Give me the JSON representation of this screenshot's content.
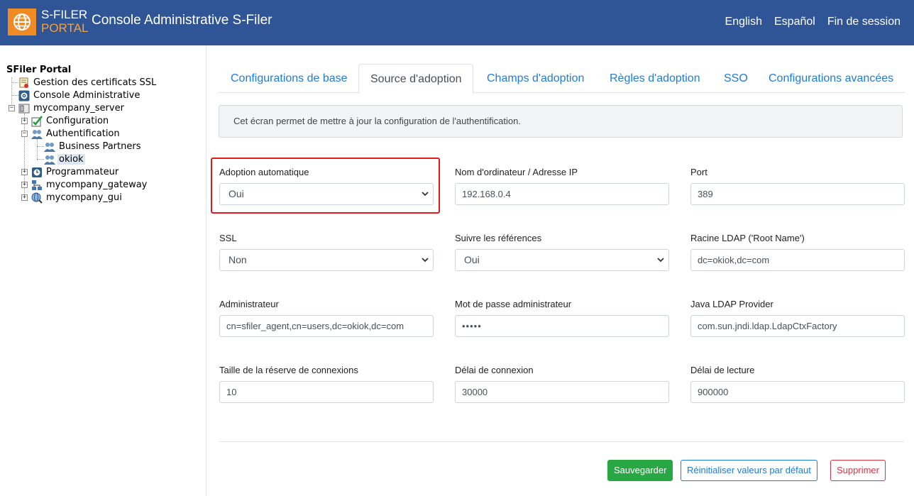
{
  "header": {
    "logo_line1": "S-FILER",
    "logo_line2": "PORTAL",
    "title": "Console Administrative S-Filer",
    "links": [
      "English",
      "Español",
      "Fin de session"
    ]
  },
  "tree": {
    "root": "SFiler Portal",
    "items": [
      {
        "label": "Gestion des certificats SSL"
      },
      {
        "label": "Console Administrative"
      },
      {
        "label": "mycompany_server"
      },
      {
        "label": "Configuration"
      },
      {
        "label": "Authentification"
      },
      {
        "label": "Business Partners"
      },
      {
        "label": "okiok"
      },
      {
        "label": "Programmateur"
      },
      {
        "label": "mycompany_gateway"
      },
      {
        "label": "mycompany_gui"
      }
    ]
  },
  "tabs": [
    {
      "label": "Configurations de base"
    },
    {
      "label": "Source d'adoption"
    },
    {
      "label": "Champs d'adoption"
    },
    {
      "label": "Règles d'adoption"
    },
    {
      "label": "SSO"
    },
    {
      "label": "Configurations avancées"
    }
  ],
  "info_text": "Cet écran permet de mettre à jour la configuration de l'authentification.",
  "form": {
    "adoption_auto": {
      "label": "Adoption automatique",
      "value": "Oui"
    },
    "host": {
      "label": "Nom d'ordinateur / Adresse IP",
      "value": "192.168.0.4"
    },
    "port": {
      "label": "Port",
      "value": "389"
    },
    "ssl": {
      "label": "SSL",
      "value": "Non"
    },
    "referrals": {
      "label": "Suivre les références",
      "value": "Oui"
    },
    "root": {
      "label": "Racine LDAP ('Root Name')",
      "value": "dc=okiok,dc=com"
    },
    "admin": {
      "label": "Administrateur",
      "value": "cn=sfiler_agent,cn=users,dc=okiok,dc=com"
    },
    "admin_pw": {
      "label": "Mot de passe administrateur",
      "value": "•••••"
    },
    "provider": {
      "label": "Java LDAP Provider",
      "value": "com.sun.jndi.ldap.LdapCtxFactory"
    },
    "pool": {
      "label": "Taille de la réserve de connexions",
      "value": "10"
    },
    "conn_timeout": {
      "label": "Délai de connexion",
      "value": "30000"
    },
    "read_timeout": {
      "label": "Délai de lecture",
      "value": "900000"
    }
  },
  "buttons": {
    "save": "Sauvegarder",
    "reset": "Réinitialiser valeurs par défaut",
    "delete": "Supprimer"
  },
  "colors": {
    "header_bg": "#2f5597",
    "logo_orange": "#f08a24",
    "tab_link": "#1f7bd8",
    "save_green": "#28a745",
    "delete_red": "#dc3545",
    "highlight_red": "#e11b1b"
  }
}
